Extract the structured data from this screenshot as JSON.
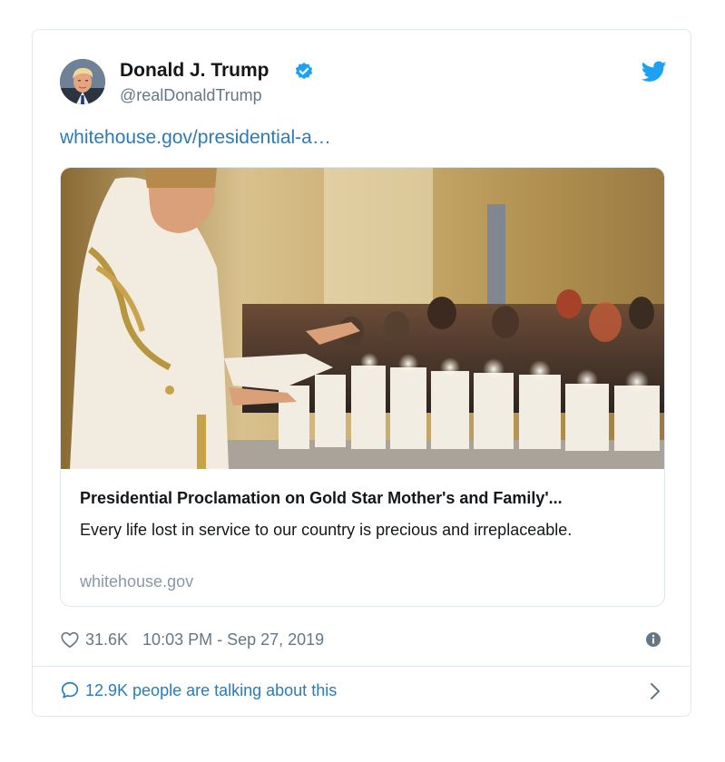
{
  "tweet": {
    "author_name": "Donald J. Trump",
    "handle": "@realDonaldTrump",
    "link_text": "whitehouse.gov/presidential-a…",
    "card": {
      "title": "Presidential Proclamation on Gold Star Mother's and Family'...",
      "description": "Every life lost in service to our country is precious and irreplaceable.",
      "domain": "whitehouse.gov"
    },
    "likes": "31.6K",
    "timestamp": "10:03 PM - Sep 27, 2019",
    "talking": "12.9K people are talking about this"
  },
  "colors": {
    "twitter_blue": "#1da1f2",
    "link_blue": "#2b7bb9",
    "muted_gray": "#657786",
    "border": "#e1e8ed"
  },
  "icons": [
    "verified-badge-icon",
    "twitter-bird-icon",
    "heart-icon",
    "info-icon",
    "speech-bubble-icon",
    "chevron-right-icon"
  ]
}
